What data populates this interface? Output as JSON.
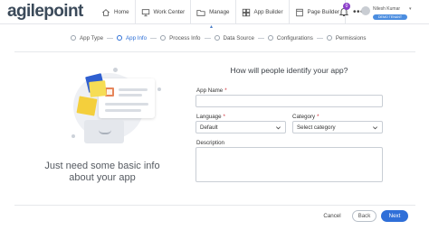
{
  "app": {
    "logo_text": "agilepoint"
  },
  "header": {
    "nav": [
      {
        "label": "Home",
        "icon": "home-icon"
      },
      {
        "label": "Work Center",
        "icon": "monitor-icon"
      },
      {
        "label": "Manage",
        "icon": "folder-icon"
      },
      {
        "label": "App Builder",
        "icon": "grid-icon"
      },
      {
        "label": "Page Builder",
        "icon": "page-icon"
      }
    ],
    "more_label": "•••",
    "notification_count": "0",
    "user_name": "Nilesh Kumar",
    "user_tenant": "DEMO TENANT"
  },
  "stepper": {
    "steps": [
      {
        "label": "App Type",
        "state": "done"
      },
      {
        "label": "App Info",
        "state": "active"
      },
      {
        "label": "Process Info",
        "state": "pending"
      },
      {
        "label": "Data Source",
        "state": "pending"
      },
      {
        "label": "Configurations",
        "state": "pending"
      },
      {
        "label": "Permissions",
        "state": "pending"
      }
    ]
  },
  "left_panel": {
    "caption": "Just need some basic info about your app"
  },
  "form": {
    "title": "How will people identify your app?",
    "app_name": {
      "label": "App Name",
      "required": "*",
      "value": ""
    },
    "language": {
      "label": "Language",
      "required": "*",
      "value": "Default"
    },
    "category": {
      "label": "Category",
      "required": "*",
      "value": "Select category"
    },
    "description": {
      "label": "Description",
      "value": ""
    }
  },
  "footer": {
    "cancel_label": "Cancel",
    "back_label": "Back",
    "next_label": "Next"
  },
  "colors": {
    "accent": "#2f6fd8",
    "badge": "#8b3fc9",
    "required": "#d0303a"
  }
}
